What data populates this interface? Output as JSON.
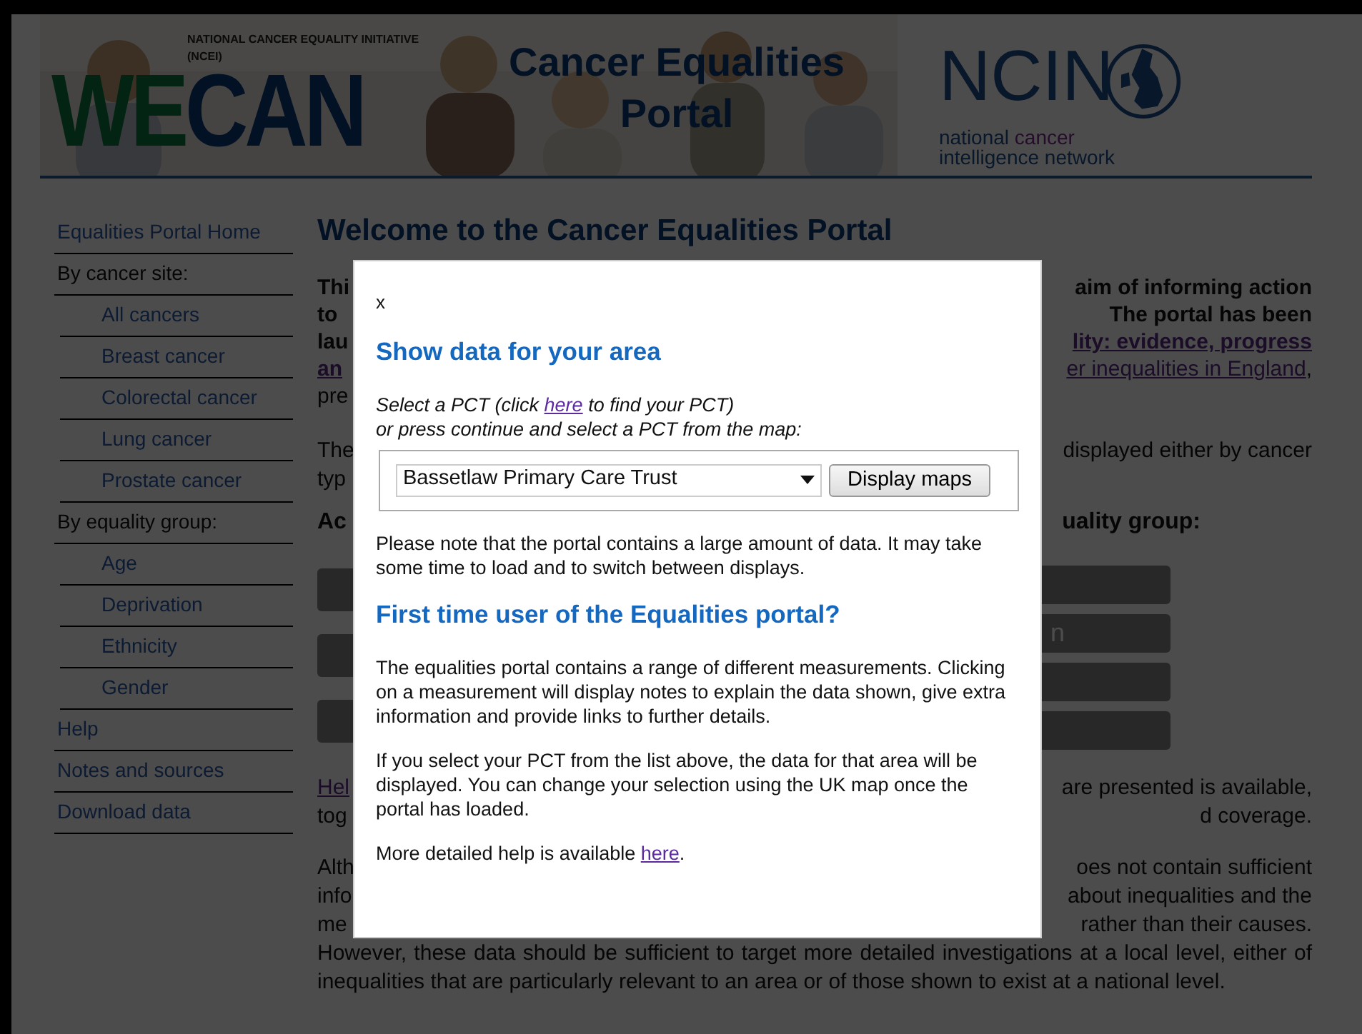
{
  "header": {
    "tagline": "NATIONAL CANCER EQUALITY INITIATIVE (NCEI)",
    "logo": [
      "WE",
      "CAN"
    ],
    "title": [
      "Cancer Equalities",
      "Portal"
    ],
    "ncin": {
      "mark": "NCIN",
      "lines": [
        [
          "national ",
          "cancer"
        ],
        [
          "intelligence network"
        ]
      ]
    }
  },
  "sidebar": [
    {
      "label": "Equalities Portal Home",
      "kind": "link"
    },
    {
      "label": "By cancer site:",
      "kind": "heading"
    },
    {
      "label": "All cancers",
      "kind": "sub"
    },
    {
      "label": "Breast cancer",
      "kind": "sub"
    },
    {
      "label": "Colorectal cancer",
      "kind": "sub"
    },
    {
      "label": "Lung cancer",
      "kind": "sub"
    },
    {
      "label": "Prostate cancer",
      "kind": "sub"
    },
    {
      "label": "By equality group:",
      "kind": "heading"
    },
    {
      "label": "Age",
      "kind": "sub"
    },
    {
      "label": "Deprivation",
      "kind": "sub"
    },
    {
      "label": "Ethnicity",
      "kind": "sub"
    },
    {
      "label": "Gender",
      "kind": "sub"
    },
    {
      "label": "Help",
      "kind": "link"
    },
    {
      "label": "Notes and sources",
      "kind": "link"
    },
    {
      "label": "Download data",
      "kind": "link"
    }
  ],
  "main": {
    "heading": "Welcome to the Cancer Equalities Portal",
    "intro_rows": [
      {
        "left": {
          "text": "Thi",
          "kind": "bold"
        },
        "right": {
          "text": "aim of informing action",
          "kind": "bold"
        }
      },
      {
        "left": {
          "text": "to",
          "kind": "bold"
        },
        "right": {
          "text": "The portal has been",
          "kind": "bold"
        }
      },
      {
        "left": {
          "text": "lau",
          "kind": "bold"
        },
        "right": {
          "text": "lity: evidence, progress",
          "kind": "boldlink"
        }
      },
      {
        "left": {
          "text": "an",
          "kind": "boldlink"
        },
        "right": {
          "text": "er inequalities in England",
          "kind": "link",
          "after": ","
        }
      },
      {
        "left": {
          "text": "pre",
          "kind": "plain"
        }
      }
    ],
    "para2_rows": [
      {
        "left": {
          "text": "The",
          "kind": "plain"
        },
        "right": {
          "text": "displayed either by cancer",
          "kind": "plain"
        }
      },
      {
        "left": {
          "text": "typ",
          "kind": "plain"
        }
      }
    ],
    "access_heading": {
      "left": "Ac",
      "right": "uality group:"
    },
    "left_buttons": [
      {
        "kind": "blank"
      },
      {
        "kind": "blank"
      },
      {
        "kind": "blank"
      }
    ],
    "right_buttons": [
      {
        "kind": "blank"
      },
      {
        "kind": "text",
        "text": "n"
      },
      {
        "kind": "blank"
      },
      {
        "kind": "blank"
      }
    ],
    "help_rows": [
      {
        "left": {
          "text": "Hel",
          "kind": "link"
        },
        "right": {
          "text": "are presented is available,",
          "kind": "plain"
        }
      },
      {
        "left": {
          "text": "tog",
          "kind": "plain"
        },
        "right": {
          "text": "d coverage.",
          "kind": "plain"
        }
      }
    ],
    "last_rows": [
      {
        "left": {
          "text": "Alth",
          "kind": "plain"
        },
        "right": {
          "text": "oes not contain sufficient",
          "kind": "plain"
        }
      },
      {
        "left": {
          "text": "info",
          "kind": "plain"
        },
        "right": {
          "text": "about inequalities and the",
          "kind": "plain"
        }
      },
      {
        "left": {
          "text": "me",
          "kind": "plain"
        },
        "right": {
          "text": "rather than their causes.",
          "kind": "plain"
        }
      }
    ],
    "last_para": "However, these data should be sufficient to target more detailed investigations at a local level, either of inequalities that are particularly relevant to an area or of those shown to exist at a national level."
  },
  "dialog": {
    "close": "x",
    "title": "Show data for your area",
    "prompt": {
      "before": "Select a PCT (click ",
      "link": "here",
      "after": " to find your PCT)"
    },
    "prompt2": "or press continue and select a PCT from the map:",
    "select": "Bassetlaw Primary Care Trust",
    "button": "Display maps",
    "note": "Please note that the portal contains a large amount of data. It may take some time to load and to switch between displays.",
    "subtitle": "First time user of the Equalities portal?",
    "paras": [
      "The equalities portal contains a range of different measurements. Clicking on a measurement will display notes to explain the data shown, give extra information and provide links to further details.",
      "If you select your PCT from the list above, the data for that area will be displayed. You can change your selection using the UK map once the portal has loaded."
    ],
    "more": {
      "before": "More detailed help is available ",
      "link": "here",
      "after": "."
    }
  }
}
